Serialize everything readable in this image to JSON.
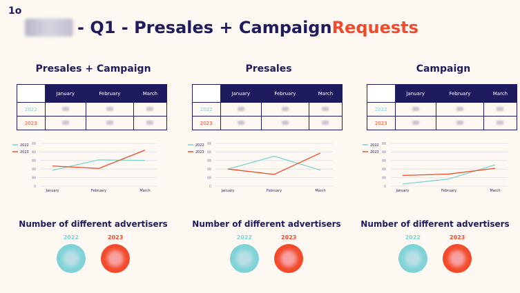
{
  "logo": "1o",
  "title": {
    "prefix": "- Q1 - Presales + Campaign ",
    "accent": "Requests"
  },
  "colors": {
    "navy": "#1e1a5e",
    "accent": "#f24a2a",
    "teal": "#7fd3cf",
    "background": "#fdf8f1"
  },
  "sections": [
    {
      "title": "Presales + Campaign",
      "columns": [
        "January",
        "February",
        "March"
      ],
      "rows": [
        {
          "year": "2022"
        },
        {
          "year": "2023"
        }
      ]
    },
    {
      "title": "Presales",
      "columns": [
        "January",
        "February",
        "March"
      ],
      "rows": [
        {
          "year": "2022"
        },
        {
          "year": "2023"
        }
      ]
    },
    {
      "title": "Campaign",
      "columns": [
        "January",
        "February",
        "March"
      ],
      "rows": [
        {
          "year": "2022"
        },
        {
          "year": "2023"
        }
      ]
    }
  ],
  "chart_data": [
    {
      "type": "line",
      "categories": [
        "January",
        "February",
        "March"
      ],
      "series": [
        {
          "name": "2022",
          "color": "#7fd3cf",
          "values": [
            26,
            43,
            42
          ]
        },
        {
          "name": "2023",
          "color": "#f24a2a",
          "values": [
            33,
            29,
            59
          ]
        }
      ],
      "ylim": [
        0,
        70
      ],
      "grid": true,
      "legend": "top-left"
    },
    {
      "type": "line",
      "categories": [
        "January",
        "February",
        "March"
      ],
      "series": [
        {
          "name": "2022",
          "color": "#7fd3cf",
          "values": [
            16,
            28,
            15
          ]
        },
        {
          "name": "2023",
          "color": "#f24a2a",
          "values": [
            16,
            11,
            31
          ]
        }
      ],
      "ylim": [
        0,
        40
      ],
      "grid": true,
      "legend": "top-left"
    },
    {
      "type": "line",
      "categories": [
        "January",
        "February",
        "March"
      ],
      "series": [
        {
          "name": "2022",
          "color": "#7fd3cf",
          "values": [
            3,
            10,
            30
          ]
        },
        {
          "name": "2023",
          "color": "#f24a2a",
          "values": [
            15,
            17,
            25
          ]
        }
      ],
      "ylim": [
        0,
        60
      ],
      "grid": true,
      "legend": "top-left"
    }
  ],
  "advertisers": [
    {
      "title": "Number of different advertisers",
      "year_a": "2022",
      "year_b": "2023"
    },
    {
      "title": "Number of different advertisers",
      "year_a": "2022",
      "year_b": "2023"
    },
    {
      "title": "Number of different advertisers",
      "year_a": "2022",
      "year_b": "2023"
    }
  ]
}
